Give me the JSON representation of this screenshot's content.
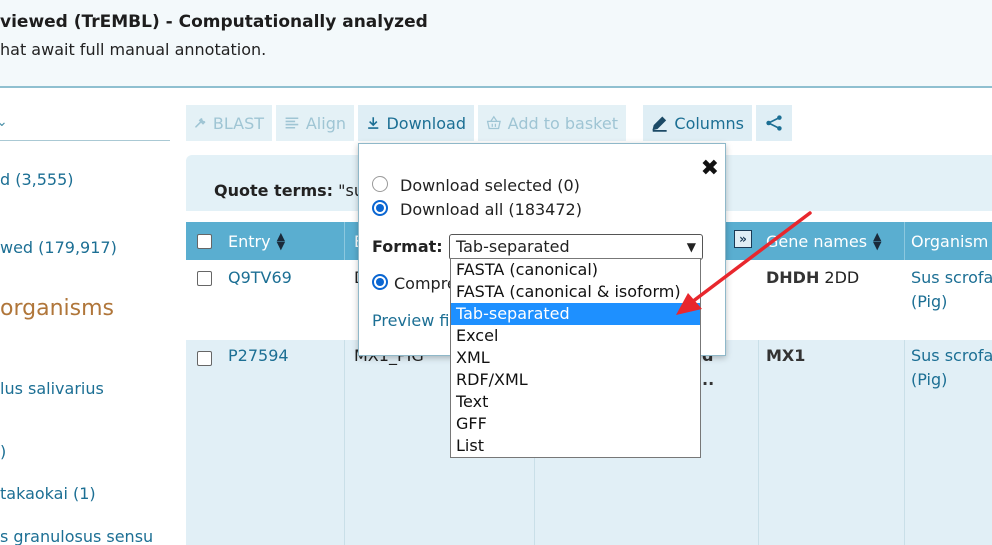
{
  "banner": {
    "title": "viewed (TrEMBL)",
    "title_rest": " - Computationally analyzed",
    "subtitle": "hat await full manual annotation."
  },
  "sidebar": {
    "links": [
      {
        "label": "d (3,555)"
      },
      {
        "label": "wed (179,917)"
      },
      {
        "label": "lus salivarius"
      },
      {
        "label": ")"
      },
      {
        "label": "takaokai (1)"
      },
      {
        "label": "s granulosus sensu"
      }
    ],
    "heading": "organisms"
  },
  "toolbar": {
    "blast": "BLAST",
    "align": "Align",
    "download": "Download",
    "basket": "Add to basket",
    "columns": "Columns"
  },
  "quote": {
    "label": "Quote terms:",
    "value": " \"su"
  },
  "table": {
    "headers": {
      "entry": "Entry",
      "entry_name_stub": "E",
      "gene_names": "Gene names",
      "organism": "Organism"
    },
    "rows": [
      {
        "entry": "Q9TV69",
        "name_stub": "D",
        "gene_bold": "DHDH",
        "gene_rest": " 2DD",
        "organism": "Sus scrofa",
        "organism_common": "(Pig)"
      },
      {
        "entry": "P27594",
        "name_stub": "MX1_PIG",
        "protein_stub_1": "d",
        "protein_stub_2": "..",
        "gene_bold": "MX1",
        "gene_rest": "",
        "organism": "Sus scrofa",
        "organism_common": "(Pig)"
      }
    ]
  },
  "download_popover": {
    "option_selected": "Download selected (0)",
    "option_all": "Download all (183472)",
    "format_label": "Format:",
    "format_value": "Tab-separated",
    "compressed_stub": "Compre",
    "preview_stub": "Preview fi",
    "close": "✖"
  },
  "format_options": [
    "FASTA (canonical)",
    "FASTA (canonical & isoform)",
    "Tab-separated",
    "Excel",
    "XML",
    "RDF/XML",
    "Text",
    "GFF",
    "List"
  ],
  "selected_format_index": 2,
  "colors": {
    "accent": "#1c6f94",
    "header": "#5aaed0",
    "highlight": "#1e90ff",
    "annotation_arrow": "#e8272d"
  }
}
